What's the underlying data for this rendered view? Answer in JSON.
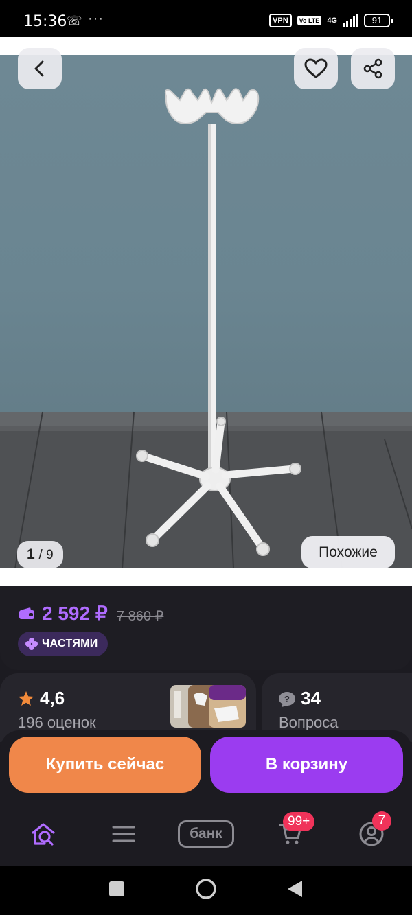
{
  "status_bar": {
    "time": "15:36",
    "call_icon": "missed-call-icon",
    "more_indicator": "···",
    "vpn_label": "VPN",
    "volte_label": "Vo LTE",
    "network_label": "4G",
    "battery_level": "91"
  },
  "gallery": {
    "current_index": "1",
    "separator_total": "/ 9",
    "similar_label": "Похожие",
    "back_icon": "chevron-left-icon",
    "favorite_icon": "heart-icon",
    "share_icon": "share-icon"
  },
  "price_block": {
    "price": "2 592 ₽",
    "old_price": "7 860 ₽",
    "installments_label": "ЧАСТЯМИ",
    "accent_color": "#b06cff"
  },
  "rating": {
    "value": "4,6",
    "count_label": "196 оценок",
    "star_color": "#f28a3a"
  },
  "questions": {
    "count": "34",
    "label": "Вопроса"
  },
  "actions": {
    "buy_now": "Купить сейчас",
    "add_to_cart": "В корзину",
    "buy_color": "#f0874a",
    "cart_color": "#9b3cf0"
  },
  "bottom_nav": {
    "home_icon": "home-search-icon",
    "catalog_icon": "menu-icon",
    "bank_label": "банк",
    "cart_badge": "99+",
    "profile_badge": "7"
  }
}
